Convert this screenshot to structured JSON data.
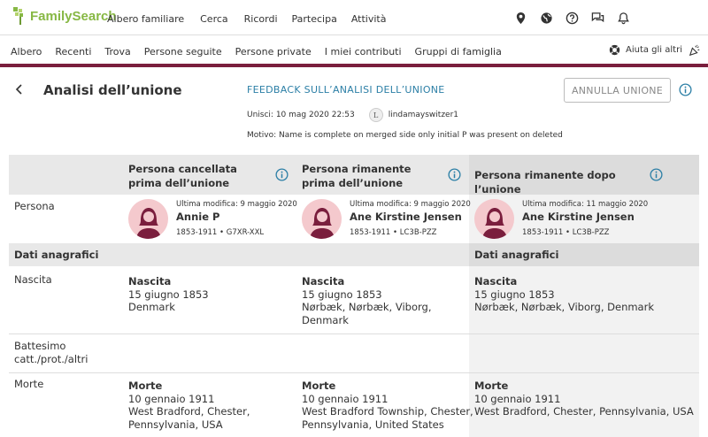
{
  "brand": {
    "logo_text": "FamilySearch",
    "accent": "#87b844",
    "bar_color": "#7a1e3d"
  },
  "topnav": {
    "items": [
      "Albero familiare",
      "Cerca",
      "Ricordi",
      "Partecipa",
      "Attività"
    ],
    "icons": [
      "location-icon",
      "globe-icon",
      "help-icon",
      "messages-icon",
      "bell-icon"
    ]
  },
  "subnav": {
    "items": [
      "Albero",
      "Recenti",
      "Trova",
      "Persone seguite",
      "Persone private",
      "I miei contributi",
      "Gruppi di famiglia"
    ],
    "help_label": "Aiuta gli altri"
  },
  "header": {
    "title": "Analisi dell’unione",
    "feedback": "FEEDBACK SULL’ANALISI DELL’UNIONE",
    "cancel_label": "ANNULLA UNIONE",
    "merged_text": "Unisci: 10 mag 2020 22:53",
    "user_initial": "L",
    "user_name": "lindamayswitzer1",
    "reason": "Motivo: Name is complete on merged side only initial P was present on deleted"
  },
  "columns": [
    {
      "header": "Persona cancellata prima dell’unione",
      "modified": "Ultima modifica: 9 maggio 2020",
      "name": "Annie P",
      "meta": "1853-1911 • G7XR-XXL",
      "birth_title": "Nascita",
      "birth_date": "15 giugno 1853",
      "birth_place_1": "Denmark",
      "birth_place_2": "",
      "death_title": "Morte",
      "death_date": "10 gennaio 1911",
      "death_place_1": "West Bradford, Chester,",
      "death_place_2": "Pennsylvania, USA"
    },
    {
      "header": "Persona rimanente prima dell’unione",
      "modified": "Ultima modifica: 9 maggio 2020",
      "name": "Ane Kirstine Jensen",
      "meta": "1853-1911 • LC3B-PZZ",
      "birth_title": "Nascita",
      "birth_date": "15 giugno 1853",
      "birth_place_1": "Nørbæk, Nørbæk, Viborg,",
      "birth_place_2": "Denmark",
      "death_title": "Morte",
      "death_date": "10 gennaio 1911",
      "death_place_1": "West Bradford Township, Chester,",
      "death_place_2": "Pennsylvania, United States"
    },
    {
      "header": "Persona rimanente dopo l’unione",
      "modified": "Ultima modifica: 11 maggio 2020",
      "name": "Ane Kirstine Jensen",
      "meta": "1853-1911 • LC3B-PZZ",
      "birth_title": "Nascita",
      "birth_date": "15 giugno 1853",
      "birth_place_1": "Nørbæk, Nørbæk, Viborg, Denmark",
      "birth_place_2": "",
      "death_title": "Morte",
      "death_date": "10 gennaio 1911",
      "death_place_1": "West Bradford, Chester, Pennsylvania, USA",
      "death_place_2": ""
    }
  ],
  "rows": {
    "person": "Persona",
    "section": "Dati anagrafici",
    "birth": "Nascita",
    "baptism_1": "Battesimo",
    "baptism_2": "catt./prot./altri",
    "death": "Morte"
  }
}
